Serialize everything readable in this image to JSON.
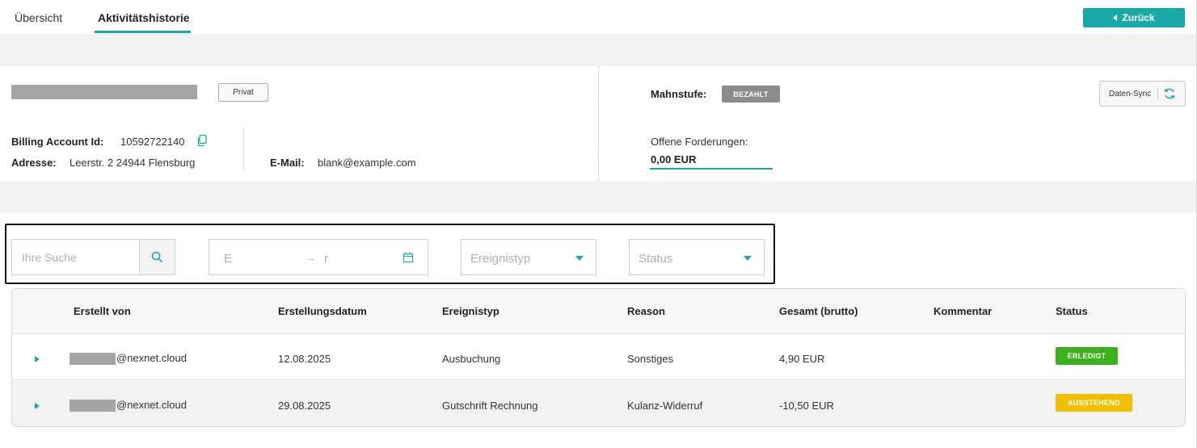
{
  "tabs": [
    {
      "label": "Übersicht",
      "active": false
    },
    {
      "label": "Aktivitätshistorie",
      "active": true
    }
  ],
  "header": {
    "back_label": "Zurück"
  },
  "account": {
    "type_badge": "Privat",
    "billing_label": "Billing Account Id:",
    "billing_id": "10592722140",
    "address_label": "Adresse:",
    "address": "Leerstr. 2 24944 Flensburg",
    "email_label": "E-Mail:",
    "email": "blank@example.com",
    "mahnstufe_label": "Mahnstufe:",
    "mahnstufe_value": "BEZAHLT",
    "sync_label": "Daten-Sync",
    "offene_label": "Offene Forderungen:",
    "offene_value": "0,00 EUR"
  },
  "filters": {
    "search_placeholder": "Ihre Suche",
    "date_start": "E",
    "date_arrow": "→",
    "date_end": "r",
    "event_type_placeholder": "Ereignistyp",
    "status_placeholder": "Status"
  },
  "table": {
    "columns": [
      "Erstellt von",
      "Erstellungsdatum",
      "Ereignistyp",
      "Reason",
      "Gesamt (brutto)",
      "Kommentar",
      "Status"
    ],
    "rows": [
      {
        "user": "@nexnet.cloud",
        "date": "12.08.2025",
        "event": "Ausbuchung",
        "reason": "Sonstiges",
        "total": "4,90 EUR",
        "comment": "",
        "status": "ERLEDIGT"
      },
      {
        "user": "@nexnet.cloud",
        "date": "29.08.2025",
        "event": "Gutschrift Rechnung",
        "reason": "Kulanz-Widerruf",
        "total": "-10,50 EUR",
        "comment": "",
        "status": "AUSSTEHEND"
      }
    ]
  },
  "colors": {
    "accent": "#19a9a8",
    "done": "#3bb11e",
    "pending": "#f0c000",
    "paid_badge": "#8c8c8c"
  }
}
